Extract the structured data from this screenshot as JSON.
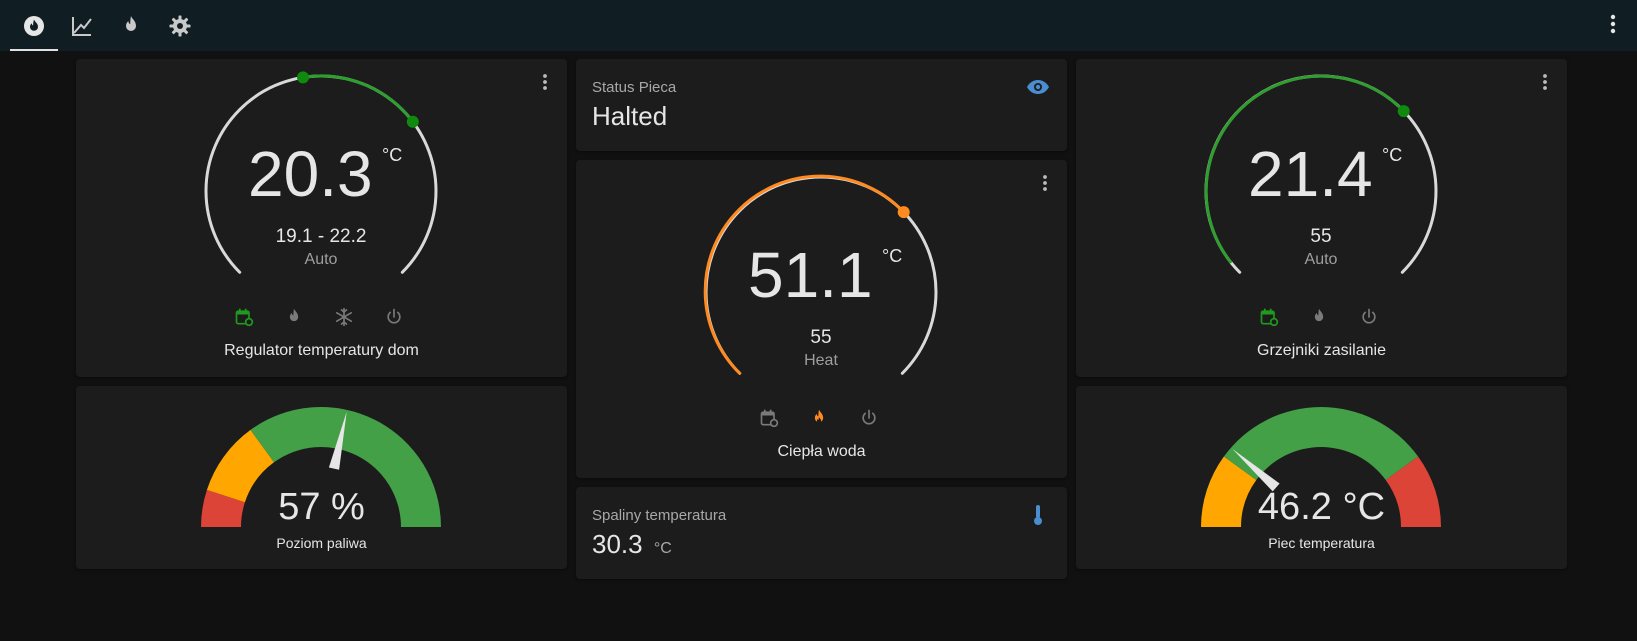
{
  "colors": {
    "background": "#111111",
    "topbar": "#101e24",
    "card": "#1c1c1c",
    "auto_green": "#2e9e2e",
    "heat_orange": "#ff8a1f",
    "icon_blue": "#4a8ed1",
    "gauge_red": "#db4437",
    "gauge_orange": "#ffa600",
    "gauge_green": "#43a047"
  },
  "topbar": {
    "tabs": [
      {
        "icon": "fire-circle-icon",
        "active": true
      },
      {
        "icon": "chart-line-icon",
        "active": false
      },
      {
        "icon": "fire-icon",
        "active": false
      },
      {
        "icon": "gear-icon",
        "active": false
      }
    ],
    "menu_icon": "dots-vertical-icon"
  },
  "thermostat_home": {
    "value": "20.3",
    "unit": "°C",
    "target": "19.1 - 22.2",
    "mode": "Auto",
    "name": "Regulator temperatury dom",
    "modes": [
      "calendar-sync-icon",
      "fire-icon",
      "snowflake-icon",
      "power-icon"
    ]
  },
  "status_pieca": {
    "label": "Status Pieca",
    "state": "Halted",
    "icon": "eye-icon"
  },
  "thermostat_water": {
    "value": "51.1",
    "unit": "°C",
    "target": "55",
    "mode": "Heat",
    "name": "Ciepła woda",
    "modes": [
      "calendar-sync-icon",
      "fire-icon",
      "power-icon"
    ]
  },
  "thermostat_radiators": {
    "value": "21.4",
    "unit": "°C",
    "target": "55",
    "mode": "Auto",
    "name": "Grzejniki zasilanie",
    "modes": [
      "calendar-sync-icon",
      "fire-icon",
      "power-icon"
    ]
  },
  "gauge_fuel": {
    "value": "57 %",
    "name": "Poziom paliwa",
    "level_percent": 57
  },
  "spaliny": {
    "label": "Spaliny temperatura",
    "value": "30.3",
    "unit": "°C",
    "icon": "thermometer-icon"
  },
  "gauge_piec": {
    "value": "46.2 °C",
    "name": "Piec temperatura",
    "level_percent": 23
  }
}
